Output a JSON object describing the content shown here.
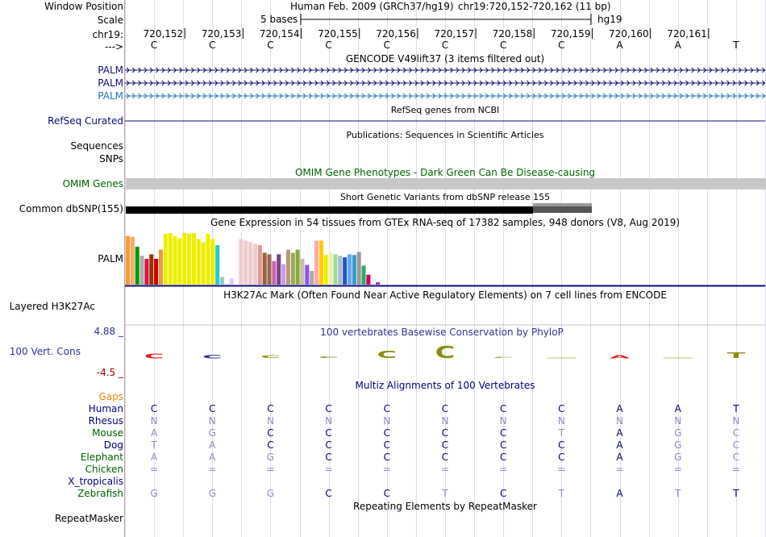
{
  "labels": {
    "window_position": "Window Position",
    "scale": "Scale",
    "chrom": "chr19:",
    "strand": "--->",
    "palm": "PALM",
    "refseq": "RefSeq Curated",
    "sequences": "Sequences",
    "snps": "SNPs",
    "omim": "OMIM Genes",
    "dbsnp": "Common dbSNP(155)",
    "gtex_palm": "PALM",
    "h3k27ac": "Layered H3K27Ac",
    "cons_max": "4.88 _",
    "cons_name": "100 Vert. Cons",
    "cons_min": "-4.5 _",
    "gaps": "Gaps",
    "repeatmasker": "RepeatMasker"
  },
  "header": {
    "assembly": "Human Feb. 2009 (GRCh37/hg19)",
    "position": "chr19:720,152-720,162 (11 bp)",
    "scale_text": "5 bases",
    "db": "hg19"
  },
  "ruler": {
    "positions": [
      "720,152",
      "720,153",
      "720,154",
      "720,155",
      "720,156",
      "720,157",
      "720,158",
      "720,159",
      "720,160",
      "720,161"
    ],
    "bases": [
      "C",
      "C",
      "C",
      "C",
      "C",
      "C",
      "C",
      "C",
      "A",
      "A",
      "T"
    ]
  },
  "tracks": {
    "gencode_title": "GENCODE V49lift37 (3 items filtered out)",
    "refseq_title": "RefSeq genes from NCBI",
    "pubs_title": "Publications: Sequences in Scientific Articles",
    "omim_title": "OMIM Gene Phenotypes - Dark Green Can Be Disease-causing",
    "dbsnp_title": "Short Genetic Variants from dbSNP release 155",
    "gtex_title": "Gene Expression in 54 tissues from GTEx RNA-seq of 17382 samples, 948 donors (V8, Aug 2019)",
    "h3k27ac_title": "H3K27Ac Mark (Often Found Near Active Regulatory Elements) on 7 cell lines from ENCODE",
    "phylop_title": "100 vertebrates Basewise Conservation by PhyloP",
    "multiz_title": "Multiz Alignments of 100 Vertebrates",
    "rmsk_title": "Repeating Elements by RepeatMasker"
  },
  "gtex": {
    "values": [
      64,
      63,
      50,
      38,
      34,
      40,
      34,
      46,
      67,
      68,
      64,
      61,
      68,
      67,
      68,
      60,
      56,
      67,
      60,
      52,
      10,
      1,
      8,
      0,
      60,
      58,
      56,
      54,
      52,
      42,
      40,
      31,
      40,
      27,
      46,
      42,
      46,
      34,
      26,
      18,
      58,
      58,
      39,
      42,
      40,
      38,
      36,
      40,
      39,
      43,
      25,
      13,
      1,
      3
    ],
    "colors": [
      "#ff9933",
      "#ffaa66",
      "#009900",
      "#aaaaaa",
      "#dd1144",
      "#993300",
      "#cc0000",
      "#ee9944",
      "#eeee00",
      "#eeee00",
      "#eeee00",
      "#eeee00",
      "#eeee00",
      "#eeee00",
      "#eeee00",
      "#eeee00",
      "#eeee00",
      "#eeee00",
      "#eeee00",
      "#22cccc",
      "#99cccc",
      "#cccccc",
      "#ddccff",
      "#cc99ee",
      "#eecccc",
      "#eecccc",
      "#eecccc",
      "#eecccc",
      "#dd9999",
      "#996633",
      "#996655",
      "#cc66aa",
      "#774488",
      "#cc99ee",
      "#bb9977",
      "#99aa55",
      "#88aa33",
      "#ccbbaa",
      "#8855ee",
      "#aaaaaa",
      "#ffaaaa",
      "#ffcc00",
      "#eeee00",
      "#eeeeaa",
      "#99dd99",
      "#aabbcc",
      "#2255cc",
      "#66aaee",
      "#3399cc",
      "#999999",
      "#33aa66",
      "#cc0066",
      "#ddccdd",
      "#aa22cc"
    ]
  },
  "phylop": {
    "values": [
      -1.2,
      -0.9,
      0.7,
      0.4,
      2.0,
      3.2,
      0.2,
      0.0,
      -0.8,
      0.0,
      1.5
    ]
  },
  "multiz": {
    "species": [
      "Human",
      "Rhesus",
      "Mouse",
      "Dog",
      "Elephant",
      "Chicken",
      "X_tropicalis",
      "Zebrafish"
    ],
    "rows": [
      [
        "C",
        "C",
        "C",
        "C",
        "C",
        "C",
        "C",
        "C",
        "A",
        "A",
        "T"
      ],
      [
        "N",
        "N",
        "N",
        "N",
        "N",
        "N",
        "N",
        "N",
        "N",
        "N",
        "N"
      ],
      [
        "A",
        "G",
        "C",
        "C",
        "C",
        "C",
        "C",
        "T",
        "A",
        "G",
        "C"
      ],
      [
        "T",
        "A",
        "C",
        "C",
        "C",
        "C",
        "C",
        "C",
        "A",
        "G",
        "C"
      ],
      [
        "A",
        "A",
        "G",
        "C",
        "C",
        "C",
        "C",
        "C",
        "A",
        "G",
        "C"
      ],
      [
        "=",
        "=",
        "=",
        "=",
        "=",
        "=",
        "=",
        "=",
        "=",
        "=",
        "="
      ],
      [
        "",
        "",
        "",
        "",
        "",
        "",
        "",
        "",
        "",
        "",
        ""
      ],
      [
        "G",
        "G",
        "G",
        "C",
        "C",
        "T",
        "C",
        "T",
        "A",
        "T",
        "T"
      ]
    ],
    "matches": [
      [
        true,
        true,
        true,
        true,
        true,
        true,
        true,
        true,
        true,
        true,
        true
      ],
      [
        false,
        false,
        false,
        false,
        false,
        false,
        false,
        false,
        false,
        false,
        false
      ],
      [
        false,
        false,
        true,
        true,
        true,
        true,
        true,
        false,
        true,
        false,
        false
      ],
      [
        false,
        false,
        true,
        true,
        true,
        true,
        true,
        true,
        true,
        false,
        false
      ],
      [
        false,
        false,
        false,
        true,
        true,
        true,
        true,
        true,
        true,
        false,
        false
      ],
      [
        false,
        false,
        false,
        false,
        false,
        false,
        false,
        false,
        false,
        false,
        false
      ],
      [
        false,
        false,
        false,
        false,
        false,
        false,
        false,
        false,
        false,
        false,
        false
      ],
      [
        false,
        false,
        false,
        true,
        true,
        false,
        true,
        false,
        true,
        false,
        true
      ]
    ]
  },
  "colors": {
    "gene_blue": "#0c0c78",
    "gencode_light": "#1f78b4",
    "omim_green": "#006400",
    "phylop_blue": "#323296",
    "cons_red": "#960000",
    "gaps_orange": "#e6890c",
    "species_green": "#006000",
    "species_navy": "#000080",
    "mismatch_gray": "#8c8cbe"
  }
}
